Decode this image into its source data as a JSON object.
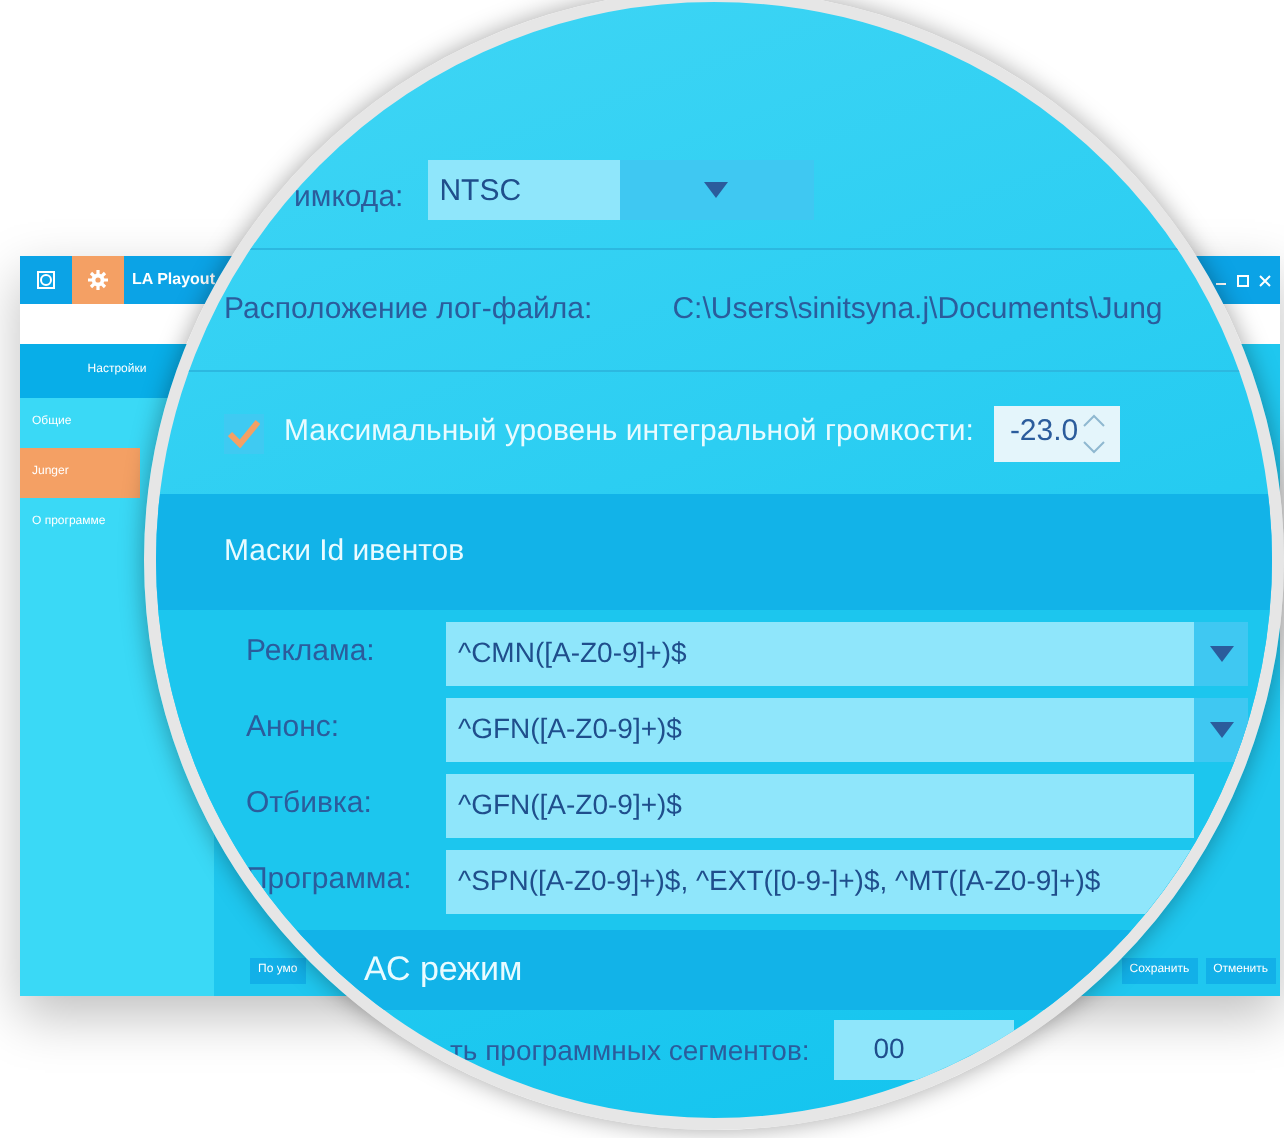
{
  "window": {
    "title": "LA Playout"
  },
  "toolbar": [
    {
      "kind": "home",
      "selected": false
    },
    {
      "kind": "settings",
      "selected": true
    }
  ],
  "sidebar": {
    "header": "Настройки",
    "items": [
      {
        "label": "Общие",
        "selected": false
      },
      {
        "label": "Junger",
        "selected": true
      },
      {
        "label": "О программе",
        "selected": false
      }
    ]
  },
  "footer_buttons": [
    {
      "label": "По умо"
    },
    {
      "label": "Сохранить"
    },
    {
      "label": "Отменить"
    }
  ],
  "magnifier": {
    "timecode": {
      "label": "имкода:",
      "value": "NTSC"
    },
    "log": {
      "label": "Расположение лог-файла:",
      "value": "C:\\Users\\sinitsyna.j\\Documents\\Jung"
    },
    "loudness": {
      "checked": true,
      "label": "Максимальный уровень интегральной громкости:",
      "value": "-23.0"
    },
    "masks": {
      "title": "Маски Id ивентов",
      "rows": [
        {
          "label": "Реклама:",
          "value": "^CMN([A-Z0-9]+)$",
          "dropdown": true
        },
        {
          "label": "Анонс:",
          "value": "^GFN([A-Z0-9]+)$",
          "dropdown": true
        },
        {
          "label": "Отбивка:",
          "value": "^GFN([A-Z0-9]+)$",
          "dropdown": false
        },
        {
          "label": "Программа:",
          "value": "^SPN([A-Z0-9]+)$, ^EXT([0-9-]+)$, ^MT([A-Z0-9]+)$",
          "dropdown": false
        }
      ]
    },
    "fac": {
      "title": "АС режим"
    },
    "segments": {
      "label": "ть программных сегментов:",
      "value": "00"
    }
  }
}
